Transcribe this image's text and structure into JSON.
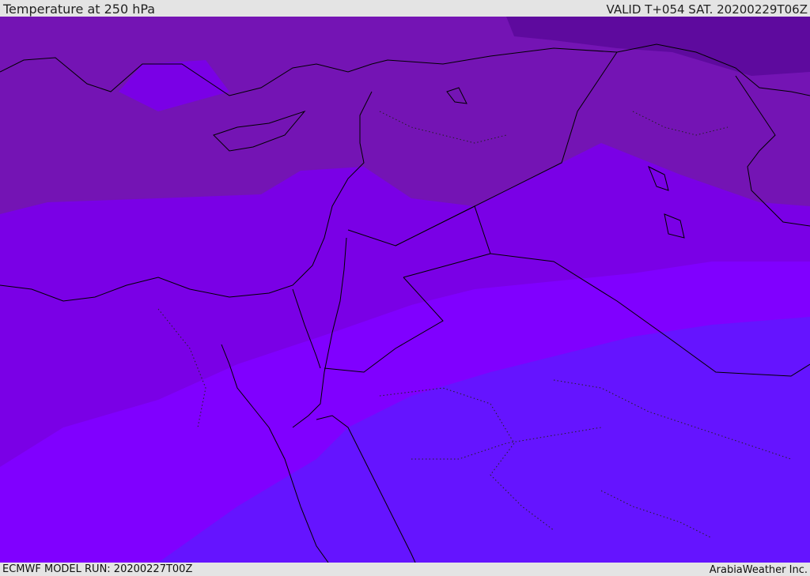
{
  "header": {
    "title": "Temperature at 250 hPa",
    "valid_time": "VALID T+054 SAT. 20200229T06Z"
  },
  "footer": {
    "model_run": "ECMWF MODEL RUN: 20200227T00Z",
    "credit": "ArabiaWeather Inc."
  },
  "map": {
    "field": "temperature",
    "level": "250 hPa",
    "band_colors": {
      "coldest": "#5a0099",
      "cold": "#7012b0",
      "mid": "#7a00e6",
      "warm": "#8000ff",
      "warmest": "#6514ff"
    },
    "coastline_color": "#000000",
    "border_style": "dotted"
  }
}
